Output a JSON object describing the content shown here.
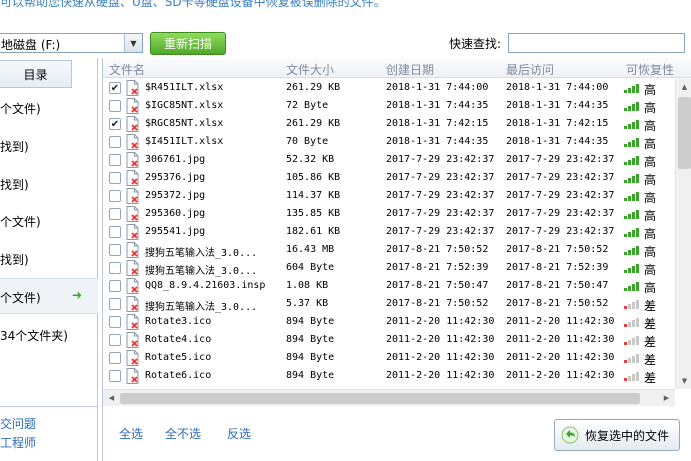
{
  "banner": {
    "text": "可以帮助您快速从硬盘、U盘、SD卡等硬盘设备中恢复被误删除的文件。"
  },
  "toolbar": {
    "drive_value": "地磁盘 (F:)",
    "rescan_label": "重新扫描",
    "search_label": "快速查找:",
    "search_value": ""
  },
  "sidebar": {
    "title": "目录",
    "items": [
      {
        "label": "个文件)"
      },
      {
        "label": "找到)"
      },
      {
        "label": "找到)"
      },
      {
        "label": "个文件)"
      },
      {
        "label": "找到)"
      },
      {
        "label": "个文件)"
      },
      {
        "label": "34个文件夹)"
      }
    ],
    "links": [
      "交问题",
      "工程师"
    ]
  },
  "table": {
    "headers": [
      "文件名",
      "文件大小",
      "创建日期",
      "最后访问",
      "可恢复性"
    ],
    "rows": [
      {
        "name": "$R451ILT.xlsx",
        "size": "261.29 KB",
        "created": "2018-1-31 7:44:00",
        "accessed": "2018-1-31 7:44:00",
        "level": "高",
        "checked": true
      },
      {
        "name": "$IGC85NT.xlsx",
        "size": "72 Byte",
        "created": "2018-1-31 7:44:35",
        "accessed": "2018-1-31 7:44:35",
        "level": "高",
        "checked": false
      },
      {
        "name": "$RGC85NT.xlsx",
        "size": "261.29 KB",
        "created": "2018-1-31 7:42:15",
        "accessed": "2018-1-31 7:42:15",
        "level": "高",
        "checked": true
      },
      {
        "name": "$I451ILT.xlsx",
        "size": "70 Byte",
        "created": "2018-1-31 7:44:35",
        "accessed": "2018-1-31 7:44:35",
        "level": "高",
        "checked": false
      },
      {
        "name": "306761.jpg",
        "size": "52.32 KB",
        "created": "2017-7-29 23:42:37",
        "accessed": "2017-7-29 23:42:37",
        "level": "高",
        "checked": false
      },
      {
        "name": "295376.jpg",
        "size": "105.86 KB",
        "created": "2017-7-29 23:42:37",
        "accessed": "2017-7-29 23:42:37",
        "level": "高",
        "checked": false
      },
      {
        "name": "295372.jpg",
        "size": "114.37 KB",
        "created": "2017-7-29 23:42:37",
        "accessed": "2017-7-29 23:42:37",
        "level": "高",
        "checked": false
      },
      {
        "name": "295360.jpg",
        "size": "135.85 KB",
        "created": "2017-7-29 23:42:37",
        "accessed": "2017-7-29 23:42:37",
        "level": "高",
        "checked": false
      },
      {
        "name": "295541.jpg",
        "size": "182.61 KB",
        "created": "2017-7-29 23:42:37",
        "accessed": "2017-7-29 23:42:37",
        "level": "高",
        "checked": false
      },
      {
        "name": "搜狗五笔输入法_3.0...",
        "size": "16.43 MB",
        "created": "2017-8-21 7:50:52",
        "accessed": "2017-8-21 7:50:52",
        "level": "高",
        "checked": false
      },
      {
        "name": "搜狗五笔输入法_3.0...",
        "size": "604 Byte",
        "created": "2017-8-21 7:52:39",
        "accessed": "2017-8-21 7:52:39",
        "level": "高",
        "checked": false
      },
      {
        "name": "QQ8_8.9.4.21603.insp",
        "size": "1.08 KB",
        "created": "2017-8-21 7:50:47",
        "accessed": "2017-8-21 7:50:47",
        "level": "高",
        "checked": false
      },
      {
        "name": "搜狗五笔输入法_3.0...",
        "size": "5.37 KB",
        "created": "2017-8-21 7:50:52",
        "accessed": "2017-8-21 7:50:52",
        "level": "差",
        "checked": false
      },
      {
        "name": "Rotate3.ico",
        "size": "894 Byte",
        "created": "2011-2-20 11:42:30",
        "accessed": "2011-2-20 11:42:30",
        "level": "差",
        "checked": false
      },
      {
        "name": "Rotate4.ico",
        "size": "894 Byte",
        "created": "2011-2-20 11:42:30",
        "accessed": "2011-2-20 11:42:30",
        "level": "差",
        "checked": false
      },
      {
        "name": "Rotate5.ico",
        "size": "894 Byte",
        "created": "2011-2-20 11:42:30",
        "accessed": "2011-2-20 11:42:30",
        "level": "差",
        "checked": false
      },
      {
        "name": "Rotate6.ico",
        "size": "894 Byte",
        "created": "2011-2-20 11:42:30",
        "accessed": "2011-2-20 11:42:30",
        "level": "差",
        "checked": false
      }
    ]
  },
  "footer": {
    "select_all": "全选",
    "select_none": "全不选",
    "invert": "反选",
    "recover_label": "恢复选中的文件"
  },
  "colors": {
    "high": "#3aa52a",
    "low": "#e04040",
    "rescan": "#4fa82a",
    "link": "#2a6cbd"
  },
  "icons": [
    "chevron-down-icon",
    "arrow-right-icon",
    "deleted-file-icon",
    "signal-high-icon",
    "signal-low-icon",
    "undo-arrow-icon"
  ]
}
